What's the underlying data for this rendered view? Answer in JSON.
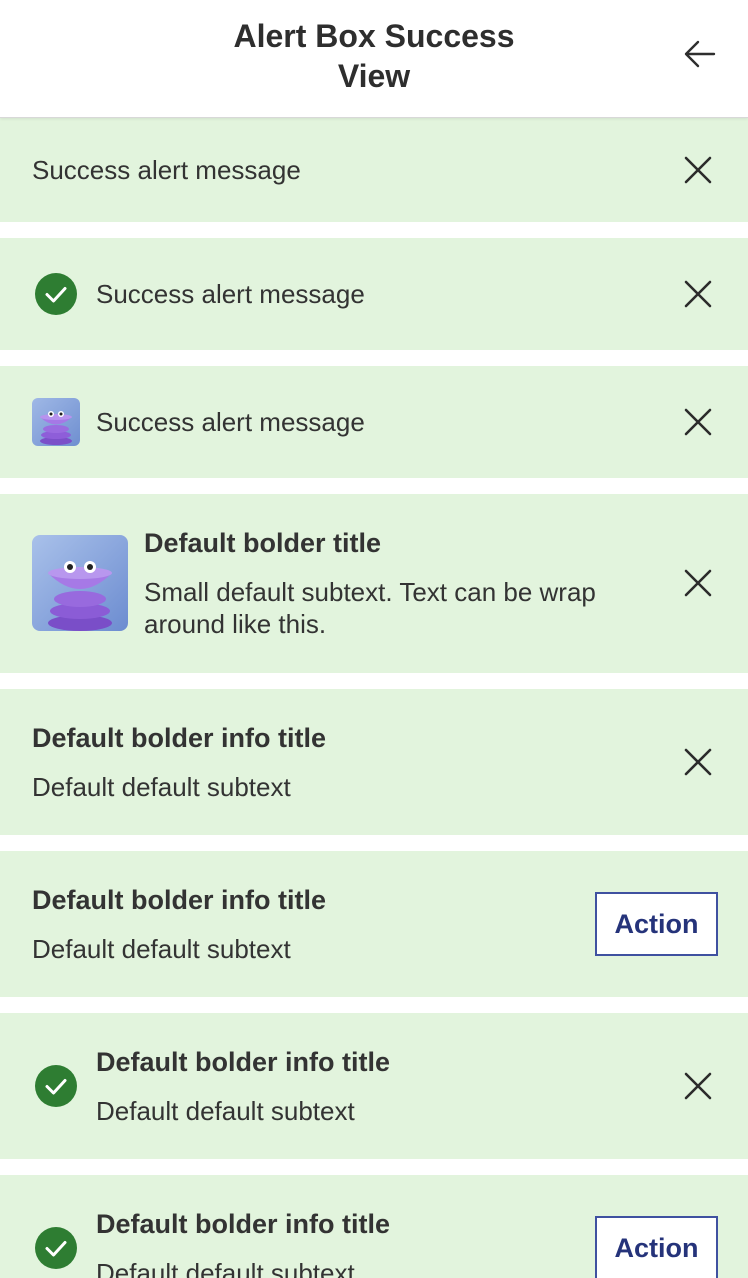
{
  "header": {
    "title": "Alert Box Success View"
  },
  "alerts": {
    "a1": {
      "message": "Success alert message"
    },
    "a2": {
      "message": "Success alert message"
    },
    "a3": {
      "message": "Success alert message"
    },
    "a4": {
      "title": "Default bolder title",
      "subtext": "Small default subtext. Text can be wrap around like this."
    },
    "a5": {
      "title": "Default bolder info title",
      "subtext": "Default default subtext"
    },
    "a6": {
      "title": "Default bolder info title",
      "subtext": "Default default subtext",
      "action": "Action"
    },
    "a7": {
      "title": "Default bolder info title",
      "subtext": "Default default subtext"
    },
    "a8": {
      "title": "Default bolder info title",
      "subtext": "Default default subtext",
      "action": "Action"
    }
  },
  "colors": {
    "alert_bg": "#e2f4dd",
    "success_icon": "#2e7d32",
    "action_border": "#3f51a0"
  },
  "icons": {
    "back": "arrow-left-icon",
    "close": "close-icon",
    "check": "check-circle-icon",
    "avatar": "avatar-image"
  }
}
